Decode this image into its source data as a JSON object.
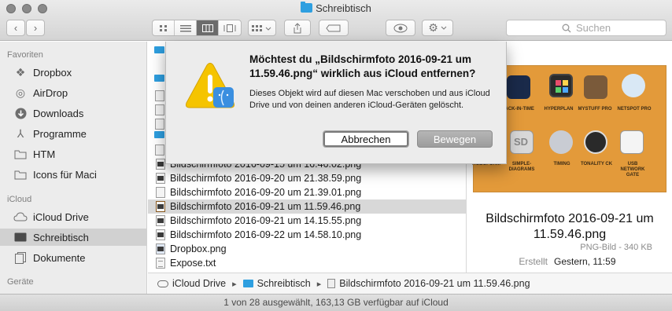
{
  "window": {
    "title": "Schreibtisch"
  },
  "toolbar": {
    "back": "‹",
    "forward": "›",
    "search_placeholder": "Suchen"
  },
  "sidebar": {
    "section_favorites": "Favoriten",
    "favorites": [
      {
        "label": "Dropbox",
        "icon": "dropbox-icon"
      },
      {
        "label": "AirDrop",
        "icon": "airdrop-icon"
      },
      {
        "label": "Downloads",
        "icon": "downloads-icon"
      },
      {
        "label": "Programme",
        "icon": "applications-icon"
      },
      {
        "label": "HTM",
        "icon": "folder-icon"
      },
      {
        "label": "Icons für Maci",
        "icon": "folder-icon"
      }
    ],
    "section_icloud": "iCloud",
    "icloud": [
      {
        "label": "iCloud Drive",
        "icon": "cloud-icon"
      },
      {
        "label": "Schreibtisch",
        "icon": "desktop-icon",
        "selected": true
      },
      {
        "label": "Dokumente",
        "icon": "documents-icon"
      }
    ],
    "section_devices": "Geräte"
  },
  "files": [
    {
      "name": "Bildschirmfoto 2016-09-15 um 16.46.02.png",
      "kind": "img"
    },
    {
      "name": "Bildschirmfoto 2016-09-20 um 21.38.59.png",
      "kind": "img"
    },
    {
      "name": "Bildschirmfoto 2016-09-20 um 21.39.01.png",
      "kind": "img"
    },
    {
      "name": "Bildschirmfoto 2016-09-21 um 11.59.46.png",
      "kind": "img",
      "selected": true
    },
    {
      "name": "Bildschirmfoto 2016-09-21 um 14.15.55.png",
      "kind": "img"
    },
    {
      "name": "Bildschirmfoto 2016-09-22 um 14.58.10.png",
      "kind": "img"
    },
    {
      "name": "Dropbox.png",
      "kind": "img"
    },
    {
      "name": "Expose.txt",
      "kind": "txt"
    }
  ],
  "pathbar": {
    "root": "iCloud Drive",
    "folder": "Schreibtisch",
    "file": "Bildschirmfoto 2016-09-21 um 11.59.46.png"
  },
  "status": "1 von 28 ausgewählt, 163,13 GB verfügbar auf iCloud",
  "preview": {
    "name": "Bildschirmfoto 2016-09-21 um 11.59.46.png",
    "type": "PNG-Bild - 340 KB",
    "meta_label": "Erstellt",
    "meta_value": "Gestern, 11:59",
    "thumb_labels": [
      "BACK-IN-TIME",
      "HYPERPLAN",
      "MYSTUFF PRO",
      "NETSPOT PRO",
      "ROBOFORM",
      "SIMPLE-DIAGRAMS",
      "TIMING",
      "TONALITY CK",
      "USB NETWORK GATE"
    ]
  },
  "dialog": {
    "title": "Möchtest du „Bildschirmfoto 2016-09-21 um 11.59.46.png“ wirklich aus iCloud entfernen?",
    "message": "Dieses Objekt wird auf diesen Mac verschoben und aus iCloud Drive und von deinen anderen iCloud-Geräten gelöscht.",
    "cancel_label": "Abbrechen",
    "move_label": "Bewegen"
  },
  "colors": {
    "folder_blue": "#2e9fe0",
    "thumb_orange": "#e39a3a",
    "warning_yellow": "#f5c400"
  }
}
